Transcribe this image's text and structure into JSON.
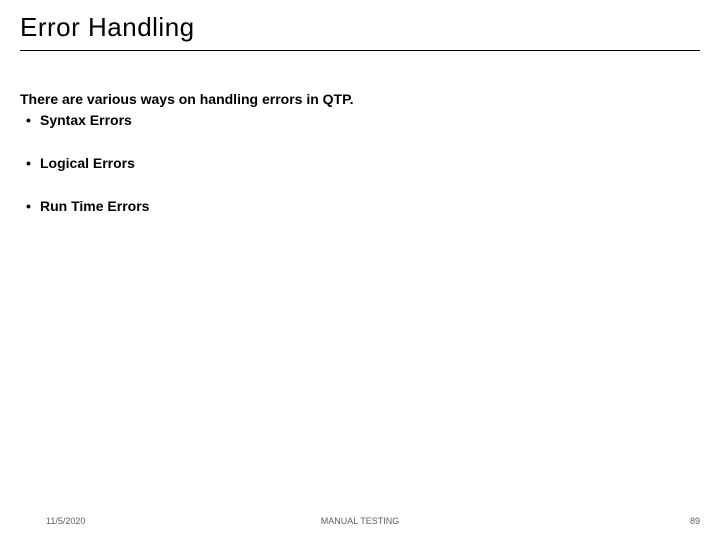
{
  "title": "Error Handling",
  "intro": "There are various ways on handling errors in QTP.",
  "bullets": [
    "Syntax Errors",
    "Logical Errors",
    "Run Time Errors"
  ],
  "footer": {
    "date": "11/5/2020",
    "center": "MANUAL TESTING",
    "page": "89"
  }
}
